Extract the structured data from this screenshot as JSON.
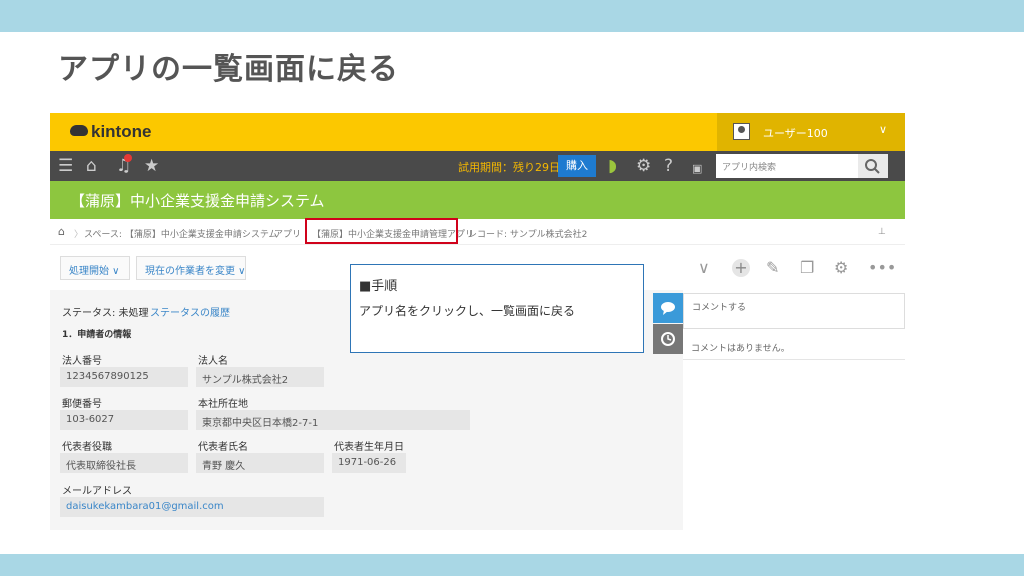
{
  "slide": {
    "title": "アプリの一覧画面に戻る"
  },
  "app": {
    "logo": "kintone",
    "user": {
      "name": "ユーザー100",
      "chevron": "∨"
    }
  },
  "toolbar": {
    "trial": "試用期間：残り29日",
    "buy_label": "購入",
    "search_placeholder": "アプリ内検索"
  },
  "space": {
    "title": "【蒲原】中小企業支援金申請システム"
  },
  "breadcrumb": {
    "space": "スペース: 【蒲原】中小企業支援金申請システム",
    "apps": "アプリ",
    "app": "【蒲原】中小企業支援金申請管理アプリ",
    "record": "レコード: サンプル株式会社2"
  },
  "actions": {
    "start_process": "処理開始",
    "change_assignee": "現在の作業者を変更"
  },
  "record": {
    "status_label": "ステータス: 未処理",
    "status_history": "ステータスの履歴",
    "section": "1．申請者の情報",
    "fields": {
      "corp_number": {
        "label": "法人番号",
        "value": "1234567890125"
      },
      "corp_name": {
        "label": "法人名",
        "value": "サンプル株式会社2"
      },
      "postal": {
        "label": "郵便番号",
        "value": "103-6027"
      },
      "address": {
        "label": "本社所在地",
        "value": "東京都中央区日本橋2-7-1"
      },
      "rep_title": {
        "label": "代表者役職",
        "value": "代表取締役社長"
      },
      "rep_name": {
        "label": "代表者氏名",
        "value": "青野 慶久"
      },
      "rep_birth": {
        "label": "代表者生年月日",
        "value": "1971-06-26"
      },
      "email": {
        "label": "メールアドレス",
        "value": "daisukekambara01@gmail.com"
      }
    }
  },
  "comments": {
    "input_placeholder": "コメントする",
    "empty": "コメントはありません。"
  },
  "callout": {
    "heading": "■手順",
    "body": "アプリ名をクリックし、一覧画面に戻る"
  },
  "colors": {
    "header": "#fcc800",
    "space_bar": "#8dc63f",
    "toolbar": "#4a4a4a",
    "highlight": "#d0021b",
    "callout_border": "#2e75b6"
  }
}
